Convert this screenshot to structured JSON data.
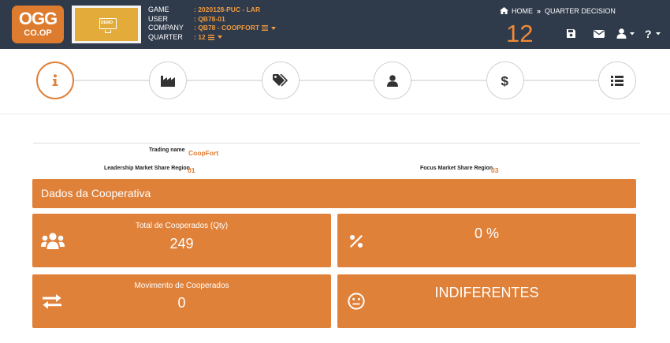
{
  "header": {
    "logo_top": "OGG",
    "logo_bottom": "CO.OP",
    "demo_label": "DEMO",
    "labels": [
      "GAME",
      "USER",
      "COMPANY",
      "QUARTER"
    ],
    "game": ": 2020128-PUC - LAR",
    "user": ": QB78-01",
    "company": ": QB78 - COOPFORT",
    "quarter": ": 12",
    "breadcrumb_home": "HOME",
    "breadcrumb_sep": "»",
    "breadcrumb_current": "QUARTER DECISION",
    "quarter_number": "12",
    "icons": [
      "save-icon",
      "mail-icon",
      "user-icon",
      "help-icon"
    ]
  },
  "stepper": {
    "steps": [
      {
        "icon": "info-icon",
        "active": true
      },
      {
        "icon": "factory-icon",
        "active": false
      },
      {
        "icon": "tags-icon",
        "active": false
      },
      {
        "icon": "user-icon",
        "active": false
      },
      {
        "icon": "dollar-icon",
        "active": false
      },
      {
        "icon": "list-icon",
        "active": false
      }
    ]
  },
  "info": {
    "trading_name_label": "Trading name",
    "trading_name_value": "CoopFort",
    "leadership_label": "Leadership Market Share Region",
    "leadership_value": "01",
    "focus_label": "Focus Market Share Region",
    "focus_value": "03"
  },
  "section_title": "Dados da Cooperativa",
  "cards": {
    "total": {
      "title": "Total de Cooperados (Qty)",
      "value": "249",
      "icon": "users-icon"
    },
    "percent": {
      "title": "",
      "value": "0 %",
      "icon": "percent-icon"
    },
    "movement": {
      "title": "Movimento de Cooperados",
      "value": "0",
      "icon": "exchange-icon"
    },
    "mood": {
      "title": "",
      "value": "INDIFERENTES",
      "icon": "meh-face-icon"
    }
  },
  "colors": {
    "header_bg": "#2f3a4b",
    "accent": "#e0813a",
    "accent_text": "#f09a3e"
  }
}
